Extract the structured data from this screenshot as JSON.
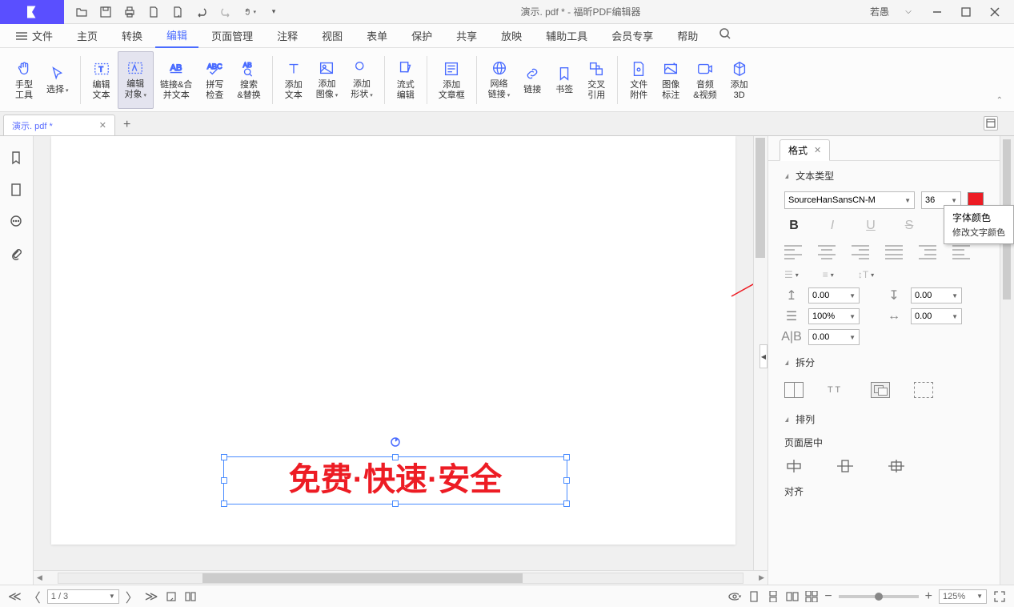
{
  "title": {
    "doc": "演示. pdf *",
    "sep": "-",
    "app": "福昕PDF编辑器",
    "full": "演示. pdf * - 福昕PDF编辑器"
  },
  "user_name": "若愚",
  "menu": {
    "file": "文件",
    "home": "主页",
    "convert": "转换",
    "edit": "编辑",
    "page": "页面管理",
    "comment": "注释",
    "view": "视图",
    "form": "表单",
    "protect": "保护",
    "share": "共享",
    "play": "放映",
    "tools": "辅助工具",
    "vip": "会员专享",
    "help": "帮助"
  },
  "ribbon": {
    "hand": "手型\n工具",
    "select": "选择",
    "edit_text": "编辑\n文本",
    "edit_obj": "编辑\n对象",
    "link_merge": "链接&合\n并文本",
    "spell": "拼写\n检查",
    "search": "搜索\n&替换",
    "add_text": "添加\n文本",
    "add_img": "添加\n图像",
    "add_shape": "添加\n形状",
    "flow_edit": "流式\n编辑",
    "add_art": "添加\n文章框",
    "web_link": "网络\n链接",
    "link": "链接",
    "bookmark": "书签",
    "cross": "交叉\n引用",
    "file_att": "文件\n附件",
    "img_ann": "图像\n标注",
    "audio": "音频\n&视频",
    "add_3d": "添加\n3D"
  },
  "tab": {
    "name": "演示. pdf *"
  },
  "canvas_text": "免费·快速·安全",
  "panel": {
    "tab": "格式",
    "text_type": "文本类型",
    "font": "SourceHanSansCN-M",
    "size": "36",
    "split": "拆分",
    "arrange": "排列",
    "page_center": "页面居中",
    "align": "对齐",
    "spacing_a": "0.00",
    "spacing_b": "0.00",
    "line_h": "100%",
    "spacing_c": "0.00",
    "spacing_d": "0.00"
  },
  "tooltip": {
    "title": "字体颜色",
    "desc": "修改文字颜色"
  },
  "status": {
    "page": "1 / 3",
    "zoom": "125%"
  },
  "colors": {
    "accent": "#4a6cff",
    "text_red": "#ed1c24"
  }
}
